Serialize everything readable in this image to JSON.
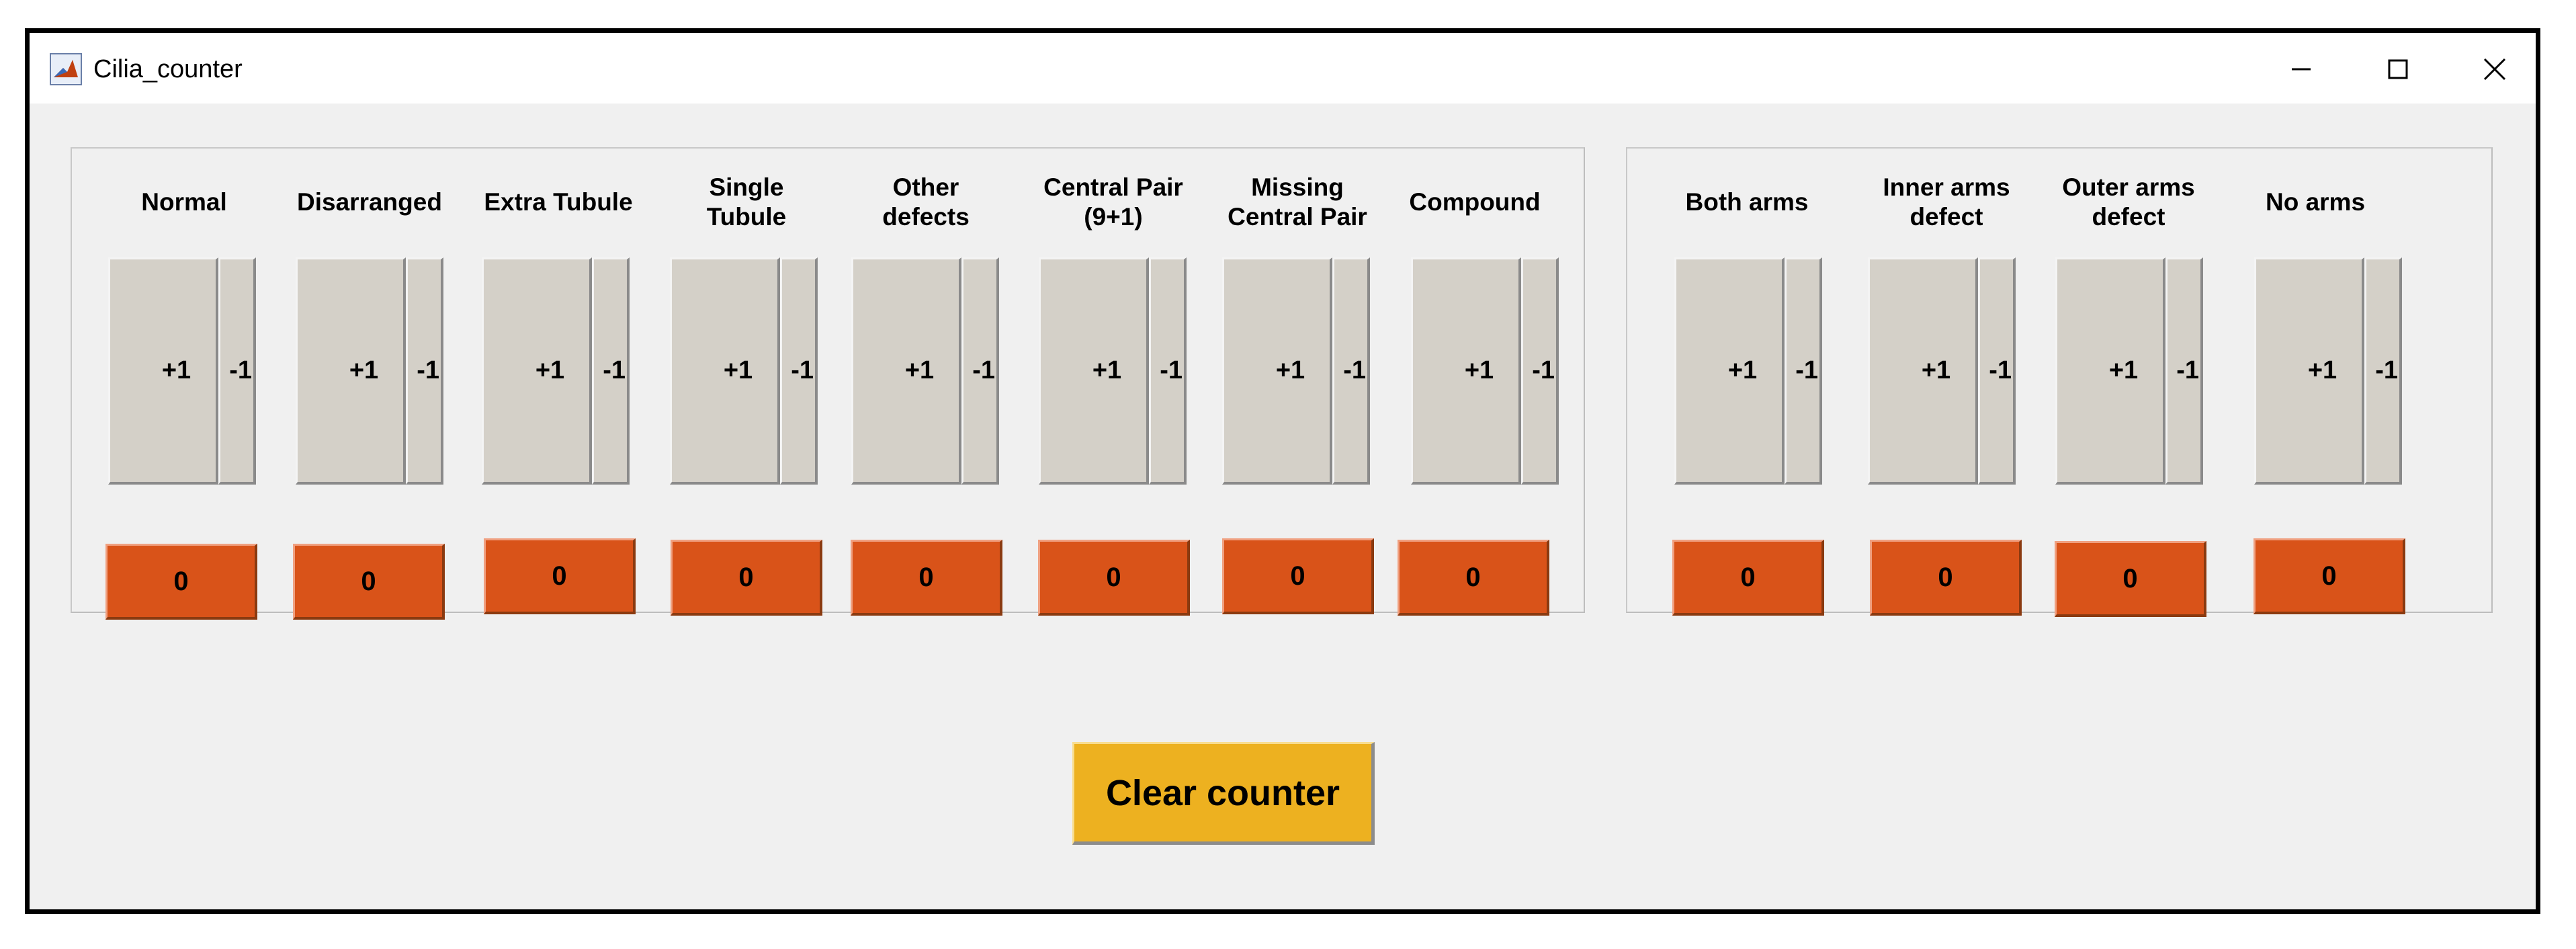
{
  "window": {
    "title": "Cilia_counter",
    "controls": {
      "minimize": "minimize-icon",
      "maximize": "maximize-icon",
      "close": "close-icon"
    }
  },
  "buttons": {
    "plus": "+1",
    "minus": "-1"
  },
  "panels": [
    {
      "counters": [
        {
          "label": "Normal",
          "count": "0"
        },
        {
          "label": "Disarranged",
          "count": "0"
        },
        {
          "label": "Extra Tubule",
          "count": "0"
        },
        {
          "label": "Single\nTubule",
          "count": "0"
        },
        {
          "label": "Other\ndefects",
          "count": "0"
        },
        {
          "label": "Central Pair\n(9+1)",
          "count": "0"
        },
        {
          "label": "Missing\nCentral Pair",
          "count": "0"
        },
        {
          "label": "Compound",
          "count": "0"
        }
      ]
    },
    {
      "counters": [
        {
          "label": "Both arms",
          "count": "0"
        },
        {
          "label": "Inner arms\ndefect",
          "count": "0"
        },
        {
          "label": "Outer arms\ndefect",
          "count": "0"
        },
        {
          "label": "No arms",
          "count": "0"
        }
      ]
    }
  ],
  "clear_button": "Clear counter",
  "colors": {
    "counter_bg": "#d95319",
    "clear_bg": "#edb120",
    "button_bg": "#d4d0c8",
    "window_bg": "#f0f0f0"
  }
}
